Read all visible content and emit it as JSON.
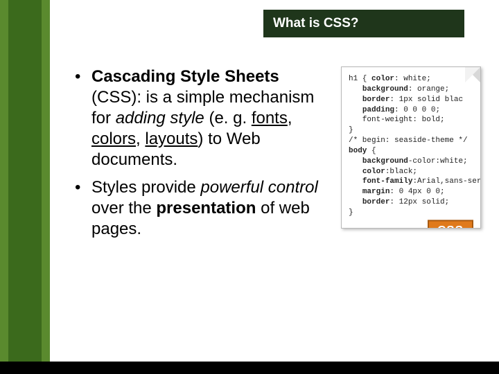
{
  "title": "What is CSS?",
  "bullets": [
    {
      "lead_bold": "Cascading Style Sheets",
      "paren": " (CSS): ",
      "mid1": "is a simple mechanism for ",
      "adding_style": "adding style",
      "eg_open": " (e. g. ",
      "fonts": "fonts",
      "sep1": ", ",
      "colors": "colors",
      "sep2": ", ",
      "layouts": "layouts",
      "close": ") to Web documents."
    },
    {
      "pre": "Styles provide ",
      "powerful_control": "powerful control",
      "mid": " over the ",
      "presentation": "presentation",
      "post": " of web pages."
    }
  ],
  "code": {
    "l1a": "h1 { ",
    "l1b": "color",
    "l1c": ": white;",
    "l2a": "   ",
    "l2b": "background",
    "l2c": ": orange;",
    "l3a": "   ",
    "l3b": "border",
    "l3c": ": 1px solid blac",
    "l4a": "   ",
    "l4b": "padding",
    "l4c": ": 0 0 0 0;",
    "l5": "   font-weight: bold;",
    "l6": "}",
    "l7": "/* begin: seaside-theme */",
    "l8a": "body",
    "l8b": " {",
    "l9a": "   ",
    "l9b": "background",
    "l9c": "-color:white;",
    "l10a": "   ",
    "l10b": "color",
    "l10c": ":black;",
    "l11a": "   ",
    "l11b": "font-family",
    "l11c": ":Arial,sans-serif",
    "l12a": "   ",
    "l12b": "margin",
    "l12c": ": 0 4px 0 0;",
    "l13a": "   ",
    "l13b": "border",
    "l13c": ": 12px solid;",
    "l14": "}"
  },
  "badge": "CSS"
}
